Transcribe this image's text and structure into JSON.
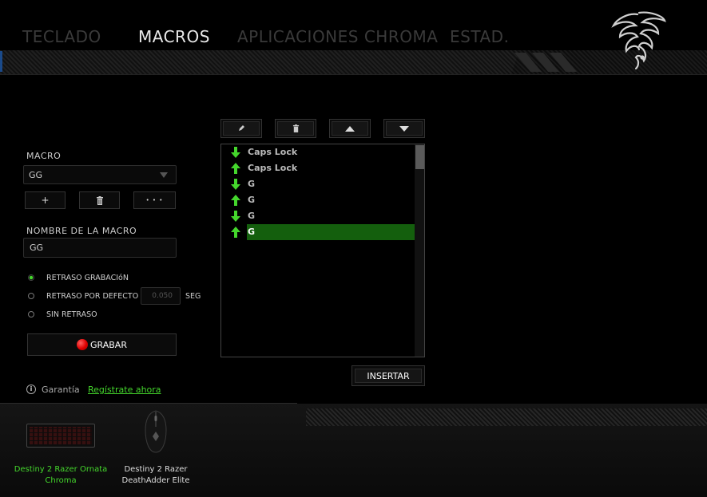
{
  "nav": {
    "tabs": [
      {
        "label": "TECLADO",
        "active": false
      },
      {
        "label": "MACROS",
        "active": true
      },
      {
        "label": "APLICACIONES CHROMA",
        "active": false
      },
      {
        "label": "ESTAD.",
        "active": false
      }
    ]
  },
  "macro": {
    "section_label": "MACRO",
    "selected": "GG",
    "add_label": "+",
    "more_label": "• • •",
    "name_label": "NOMBRE DE LA MACRO",
    "name_value": "GG"
  },
  "delay": {
    "options": [
      {
        "label": "RETRASO GRABACIóN",
        "selected": true
      },
      {
        "label": "RETRASO POR DEFECTO",
        "selected": false
      },
      {
        "label": "SIN RETRASO",
        "selected": false
      }
    ],
    "default_value": "0.050",
    "unit": "SEG"
  },
  "record_label": "GRABAR",
  "insert_label": "INSERTAR",
  "events": [
    {
      "direction": "down",
      "key": "Caps Lock",
      "selected": false
    },
    {
      "direction": "up",
      "key": "Caps Lock",
      "selected": false
    },
    {
      "direction": "down",
      "key": "G",
      "selected": false
    },
    {
      "direction": "up",
      "key": "G",
      "selected": false
    },
    {
      "direction": "down",
      "key": "G",
      "selected": false
    },
    {
      "direction": "up",
      "key": "G",
      "selected": true
    }
  ],
  "footer": {
    "warranty": "Garantía",
    "register_link": "Regístrate ahora"
  },
  "devices": [
    {
      "name": "Destiny 2 Razer Ornata Chroma",
      "line1": "Destiny 2 Razer Ornata",
      "line2": "Chroma",
      "active": true
    },
    {
      "name": "Destiny 2 Razer DeathAdder Elite",
      "line1": "Destiny 2 Razer",
      "line2": "DeathAdder Elite",
      "active": false
    }
  ],
  "colors": {
    "accent": "#44d62c",
    "selection": "#145f0d",
    "record": "#e00000",
    "inactive_tab": "#3a3a3a"
  }
}
